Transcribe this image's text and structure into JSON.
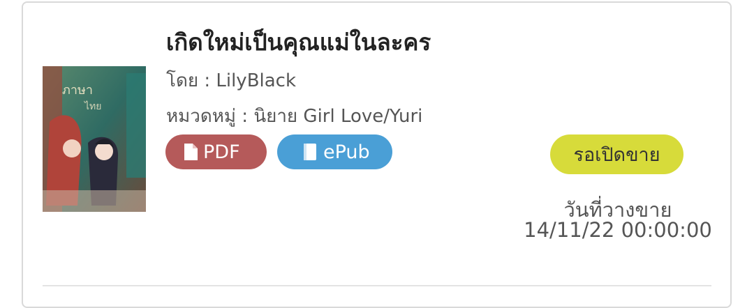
{
  "book": {
    "title": "เกิดใหม่เป็นคุณแม่ในละคร",
    "author_text": "โดย : LilyBlack",
    "category_text": "หมวดหมู่ : นิยาย Girl Love/Yuri"
  },
  "formats": {
    "pdf_label": "PDF",
    "epub_label": "ePub"
  },
  "status": {
    "label": "รอเปิดขาย",
    "release_label": "วันที่วางขาย",
    "release_date": "14/11/22 00:00:00"
  },
  "colors": {
    "pdf_button": "#b55a5a",
    "epub_button": "#4a9fd6",
    "status_badge": "#d7db3a"
  },
  "icons": {
    "pdf": "file-icon",
    "epub": "book-icon"
  }
}
